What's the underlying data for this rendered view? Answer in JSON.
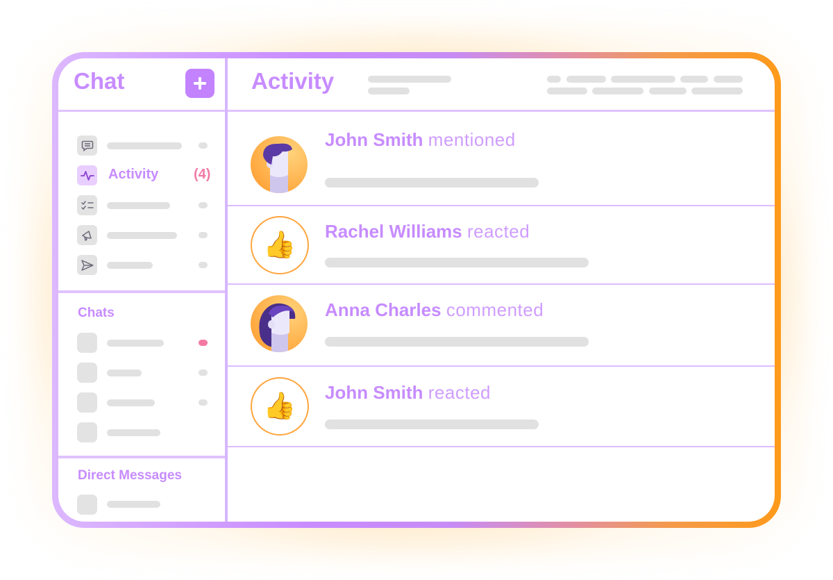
{
  "sidebar": {
    "title": "Chat",
    "add_button_icon": "plus-icon",
    "nav_items": [
      {
        "icon": "chat-bubble-icon",
        "label": "",
        "placeholder": true
      },
      {
        "icon": "activity-pulse-icon",
        "label": "Activity",
        "count": "(4)",
        "active": true
      },
      {
        "icon": "checklist-icon",
        "label": "",
        "placeholder": true
      },
      {
        "icon": "megaphone-icon",
        "label": "",
        "placeholder": true
      },
      {
        "icon": "send-icon",
        "label": "",
        "placeholder": true
      }
    ],
    "chats_title": "Chats",
    "chats_unread_indicator_color": "#f47aa3",
    "dm_title": "Direct Messages"
  },
  "main": {
    "title": "Activity",
    "feed": [
      {
        "name": "John Smith",
        "action": "mentioned",
        "avatar": "man-avatar"
      },
      {
        "name": "Rachel Williams",
        "action": "reacted",
        "avatar": "thumbs-up-icon"
      },
      {
        "name": "Anna Charles",
        "action": "commented",
        "avatar": "woman-avatar"
      },
      {
        "name": "John Smith",
        "action": "reacted",
        "avatar": "thumbs-up-icon"
      }
    ]
  },
  "colors": {
    "accent": "#c78cff",
    "badge": "#f27ba6",
    "border_start": "#dcb8ff",
    "border_end": "#ff9a1a",
    "placeholder": "#e1e1e1"
  }
}
